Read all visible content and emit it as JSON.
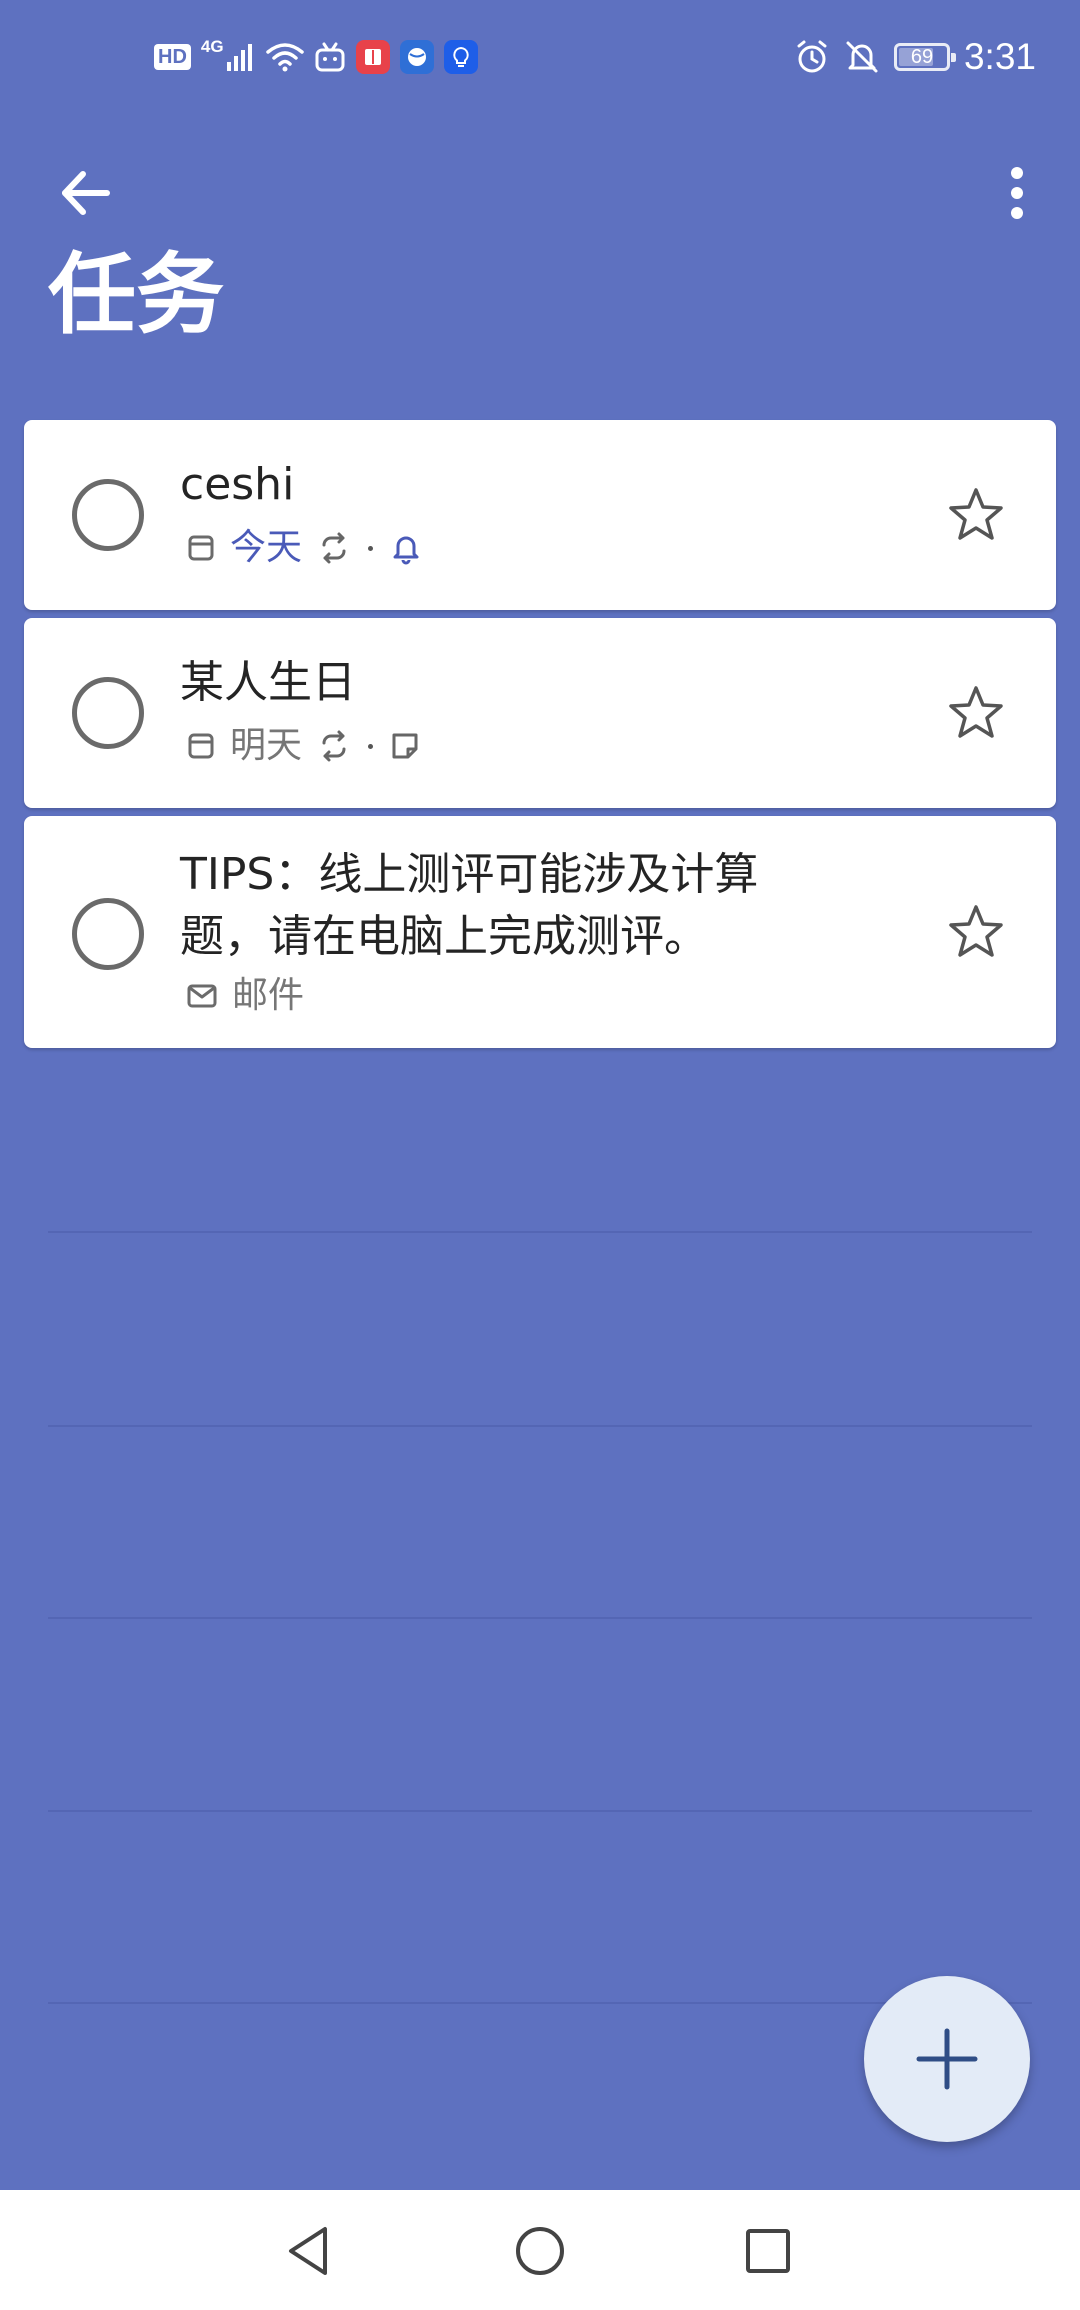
{
  "status_bar": {
    "left_icons": [
      "hd-icon",
      "4g-signal-icon",
      "wifi-icon",
      "bilibili-icon",
      "reader-app-icon",
      "browser-app-icon",
      "bulb-app-icon"
    ],
    "hd_label": "HD",
    "network_label": "4G",
    "right_icons": [
      "alarm-icon",
      "bell-off-icon",
      "battery-icon"
    ],
    "battery_level": "69",
    "time": "3:31"
  },
  "header": {
    "back_icon": "arrow-left-icon",
    "more_icon": "more-vertical-icon",
    "title": "任务"
  },
  "tasks": [
    {
      "title": "ceshi",
      "meta": [
        {
          "type": "calendar-icon"
        },
        {
          "type": "text",
          "text": "今天",
          "highlight": true
        },
        {
          "type": "repeat-icon"
        },
        {
          "type": "dot"
        },
        {
          "type": "bell-icon"
        }
      ],
      "starred": false
    },
    {
      "title": "某人生日",
      "meta": [
        {
          "type": "calendar-icon"
        },
        {
          "type": "text",
          "text": "明天",
          "highlight": false
        },
        {
          "type": "repeat-icon"
        },
        {
          "type": "dot"
        },
        {
          "type": "note-icon"
        }
      ],
      "starred": false
    },
    {
      "title": "TIPS：线上测评可能涉及计算题，请在电脑上完成测评。",
      "meta": [
        {
          "type": "mail-icon"
        },
        {
          "type": "text",
          "text": "邮件",
          "highlight": false
        }
      ],
      "starred": false
    }
  ],
  "fab": {
    "icon": "plus-icon"
  },
  "nav_bar": {
    "icons": [
      "back-triangle-icon",
      "home-circle-icon",
      "recents-square-icon"
    ]
  },
  "colors": {
    "background": "#5e71c0",
    "card": "#ffffff",
    "accent": "#4a5ab8",
    "fab": "#e3ebf7"
  }
}
